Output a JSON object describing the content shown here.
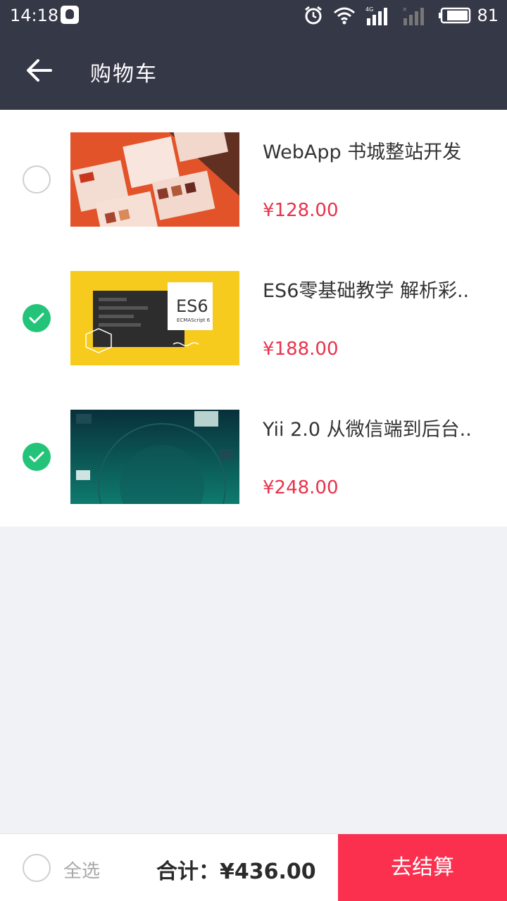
{
  "status_bar": {
    "time": "14:18",
    "battery": "81",
    "network": "4G",
    "icons": [
      "qq-icon",
      "alarm-icon",
      "wifi-icon",
      "signal-icon",
      "signal-empty-icon",
      "battery-icon"
    ]
  },
  "header": {
    "title": "购物车",
    "back_icon": "arrow-left-icon"
  },
  "items": [
    {
      "title": "WebApp 书城整站开发",
      "price": "¥128.00",
      "checked": false
    },
    {
      "title": "ES6零基础教学 解析彩..",
      "price": "¥188.00",
      "checked": true,
      "thumb_text": "ES6",
      "thumb_subtext": "ECMAScript 6"
    },
    {
      "title": "Yii 2.0 从微信端到后台..",
      "price": "¥248.00",
      "checked": true
    }
  ],
  "footer": {
    "select_all_label": "全选",
    "total_label": "合计：¥436.00",
    "checkout_label": "去结算"
  },
  "colors": {
    "header_bg": "#353847",
    "price": "#e8334a",
    "checked": "#23c47a",
    "checkout_bg": "#fb2f4e",
    "page_bg": "#f0f2f5"
  }
}
